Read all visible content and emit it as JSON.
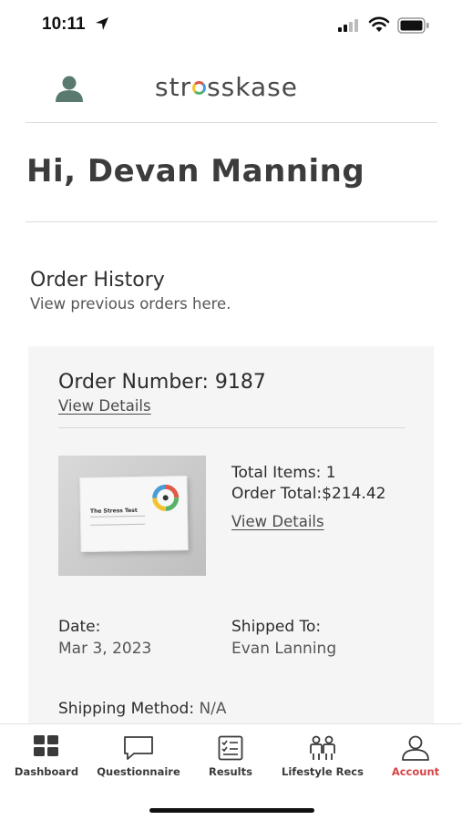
{
  "status_bar": {
    "time": "10:11"
  },
  "header": {
    "brand_pre": "str",
    "brand_post": "sskase",
    "icons": {
      "profile": "person-icon"
    }
  },
  "greeting": "Hi, Devan Manning",
  "order_history": {
    "title": "Order History",
    "subtitle": "View previous orders here."
  },
  "order": {
    "number_label": "Order Number:",
    "number": "9187",
    "view_details": "View Details",
    "product": {
      "box_title": "The Stress Test"
    },
    "total_items_label": "Total Items:",
    "total_items": "1",
    "order_total_label": "Order Total:",
    "order_total": "$214.42",
    "view_details_side": "View Details",
    "date_label": "Date:",
    "date": "Mar 3, 2023",
    "shipped_to_label": "Shipped To:",
    "shipped_to": "Evan Lanning",
    "shipping_method_label": "Shipping Method:",
    "shipping_method": "N/A"
  },
  "tabs": [
    {
      "label": "Dashboard",
      "icon": "grid-icon"
    },
    {
      "label": "Questionnaire",
      "icon": "chat-bubble-icon"
    },
    {
      "label": "Results",
      "icon": "checklist-icon"
    },
    {
      "label": "Lifestyle Recs",
      "icon": "people-icon"
    },
    {
      "label": "Account",
      "icon": "person-outline-icon"
    }
  ],
  "colors": {
    "accent": "#d64545",
    "card_bg": "#f5f5f5",
    "profile_icon": "#5a7a70",
    "logo_ring": [
      "#e05a47",
      "#4a9bd6",
      "#58b368",
      "#f2c230"
    ]
  }
}
